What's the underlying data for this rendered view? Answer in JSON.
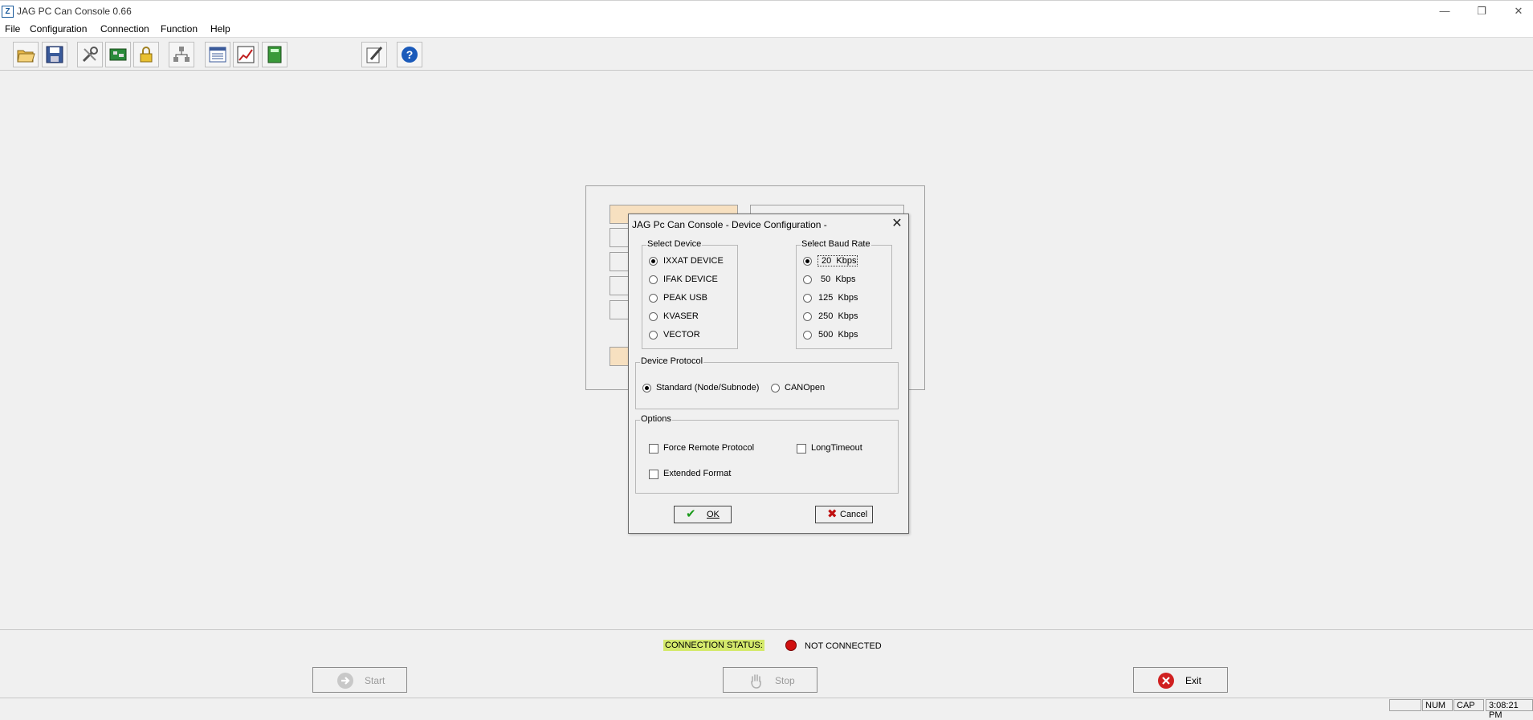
{
  "window": {
    "title": "JAG PC Can Console 0.66",
    "minimize": "—",
    "restore": "❐",
    "close": "✕",
    "icon": "Z"
  },
  "menu": [
    "File",
    "Configuration",
    "Connection",
    "Function",
    "Help"
  ],
  "toolbar_icons": [
    "open-folder-icon",
    "save-icon",
    "tools-icon",
    "circuit-board-icon",
    "lock-icon",
    "network-icon",
    "list-window-icon",
    "chart-icon",
    "book-icon",
    "edit-icon",
    "help-icon"
  ],
  "dialog": {
    "title": "JAG Pc Can Console - Device Configuration -",
    "close": "✕",
    "select_device": {
      "label": "Select Device",
      "options": [
        "IXXAT DEVICE",
        "IFAK  DEVICE",
        "PEAK USB",
        "KVASER",
        "VECTOR"
      ],
      "selected": 0
    },
    "select_baud": {
      "label": "Select Baud Rate",
      "options": [
        " 20  Kbps",
        " 50  Kbps",
        "125  Kbps",
        "250  Kbps",
        "500  Kbps"
      ],
      "selected": 0
    },
    "protocol": {
      "label": "Device Protocol",
      "options": [
        "Standard (Node/Subnode)",
        "CANOpen"
      ],
      "selected": 0
    },
    "options": {
      "label": "Options",
      "force_remote": "Force Remote Protocol",
      "long_timeout": "LongTimeout",
      "extended_format": "Extended Format"
    },
    "ok": "OK",
    "cancel": "Cancel"
  },
  "connection": {
    "label": "CONNECTION STATUS:",
    "value": "NOT CONNECTED",
    "color": "#d01010"
  },
  "buttons": {
    "start": "Start",
    "stop": "Stop",
    "exit": "Exit"
  },
  "statusbar": {
    "num": "NUM",
    "cap": "CAP",
    "time": "3:08:21 PM"
  }
}
